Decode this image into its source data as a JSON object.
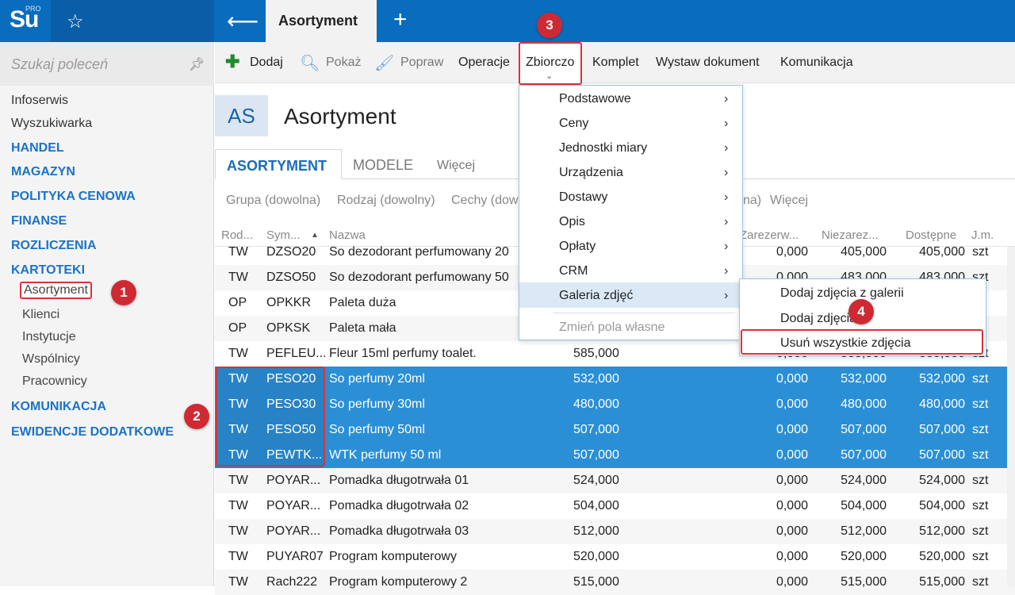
{
  "topbar": {
    "logo": "Su",
    "logo_pro": "PRO",
    "star_icon": "star-icon",
    "back_icon": "arrow-left-icon",
    "active_tab": "Asortyment",
    "plus_icon": "plus-icon"
  },
  "sidebar": {
    "search_placeholder": "Szukaj poleceń",
    "items": [
      "Infoserwis",
      "Wyszukiwarka"
    ],
    "heads": [
      "HANDEL",
      "MAGAZYN",
      "POLITYKA CENOWA",
      "FINANSE",
      "ROZLICZENIA",
      "KARTOTEKI"
    ],
    "sub_items": [
      "Asortyment",
      "Klienci",
      "Instytucje",
      "Wspólnicy",
      "Pracownicy"
    ],
    "heads2": [
      "KOMUNIKACJA",
      "EWIDENCJE DODATKOWE"
    ]
  },
  "toolbar": {
    "dodaj": "Dodaj",
    "pokaz": "Pokaż",
    "popraw": "Popraw",
    "operacje": "Operacje",
    "zbiorczo": "Zbiorczo",
    "komplet": "Komplet",
    "wystaw": "Wystaw dokument",
    "komunikacja": "Komunikacja"
  },
  "header": {
    "badge": "AS",
    "title": "Asortyment"
  },
  "tabs": {
    "asortyment": "ASORTYMENT",
    "modele": "MODELE",
    "wiecej": "Więcej"
  },
  "filters": {
    "grupa": "Grupa (dowolna)",
    "rodzaj": "Rodzaj (dowolny)",
    "cechy": "Cechy (dow",
    "na": "na)",
    "wiecej": "Więcej"
  },
  "table": {
    "headers": {
      "rod": "Rod...",
      "sym": "Sym...",
      "nazwa": "Nazwa",
      "zarezerw": "Zarezerw...",
      "niezarez": "Niezarez...",
      "dostepne": "Dostępne",
      "jm": "J.m."
    },
    "rows": [
      {
        "rod": "TW",
        "sym": "DZSO20",
        "nazwa": "So dezodorant perfumowany 20",
        "stan": "",
        "zar": "0,000",
        "niezar": "405,000",
        "dost": "405,000",
        "jm": "szt"
      },
      {
        "rod": "TW",
        "sym": "DZSO50",
        "nazwa": "So dezodorant perfumowany 50",
        "stan": "",
        "zar": "0,000",
        "niezar": "483,000",
        "dost": "483,000",
        "jm": "szt"
      },
      {
        "rod": "OP",
        "sym": "OPKKR",
        "nazwa": "Paleta duża",
        "stan": "",
        "zar": "",
        "niezar": "",
        "dost": "",
        "jm": ""
      },
      {
        "rod": "OP",
        "sym": "OPKSK",
        "nazwa": "Paleta mała",
        "stan": "",
        "zar": "",
        "niezar": "",
        "dost": "",
        "jm": ""
      },
      {
        "rod": "TW",
        "sym": "PEFLEU...",
        "nazwa": "Fleur 15ml perfumy toalet.",
        "stan": "585,000",
        "zar": "0,000",
        "niezar": "585,000",
        "dost": "585,000",
        "jm": "szt"
      },
      {
        "rod": "TW",
        "sym": "PESO20",
        "nazwa": "So perfumy 20ml",
        "stan": "532,000",
        "zar": "0,000",
        "niezar": "532,000",
        "dost": "532,000",
        "jm": "szt"
      },
      {
        "rod": "TW",
        "sym": "PESO30",
        "nazwa": "So perfumy 30ml",
        "stan": "480,000",
        "zar": "0,000",
        "niezar": "480,000",
        "dost": "480,000",
        "jm": "szt"
      },
      {
        "rod": "TW",
        "sym": "PESO50",
        "nazwa": "So perfumy 50ml",
        "stan": "507,000",
        "zar": "0,000",
        "niezar": "507,000",
        "dost": "507,000",
        "jm": "szt"
      },
      {
        "rod": "TW",
        "sym": "PEWTK...",
        "nazwa": "WTK perfumy 50 ml",
        "stan": "507,000",
        "zar": "0,000",
        "niezar": "507,000",
        "dost": "507,000",
        "jm": "szt"
      },
      {
        "rod": "TW",
        "sym": "POYAR...",
        "nazwa": "Pomadka długotrwała 01",
        "stan": "524,000",
        "zar": "0,000",
        "niezar": "524,000",
        "dost": "524,000",
        "jm": "szt"
      },
      {
        "rod": "TW",
        "sym": "POYAR...",
        "nazwa": "Pomadka długotrwała 02",
        "stan": "504,000",
        "zar": "0,000",
        "niezar": "504,000",
        "dost": "504,000",
        "jm": "szt"
      },
      {
        "rod": "TW",
        "sym": "POYAR...",
        "nazwa": "Pomadka długotrwała 03",
        "stan": "512,000",
        "zar": "0,000",
        "niezar": "512,000",
        "dost": "512,000",
        "jm": "szt"
      },
      {
        "rod": "TW",
        "sym": "PUYAR07",
        "nazwa": "Program komputerowy",
        "stan": "520,000",
        "zar": "0,000",
        "niezar": "520,000",
        "dost": "520,000",
        "jm": "szt"
      },
      {
        "rod": "TW",
        "sym": "Rach222",
        "nazwa": "Program komputerowy 2",
        "stan": "515,000",
        "zar": "0,000",
        "niezar": "515,000",
        "dost": "515,000",
        "jm": "szt"
      }
    ]
  },
  "menu": {
    "items": [
      "Podstawowe",
      "Ceny",
      "Jednostki miary",
      "Urządzenia",
      "Dostawy",
      "Opis",
      "Opłaty",
      "CRM",
      "Galeria zdjęć"
    ],
    "disabled": "Zmień pola własne"
  },
  "submenu": {
    "items": [
      "Dodaj zdjęcia z galerii",
      "Dodaj zdjęcia",
      "Usuń wszystkie zdjęcia"
    ]
  },
  "badges": [
    "1",
    "2",
    "3",
    "4"
  ],
  "colors": {
    "brand": "#0a6cbd",
    "selection": "#2b8fd6",
    "highlight_red": "#d9333a"
  }
}
